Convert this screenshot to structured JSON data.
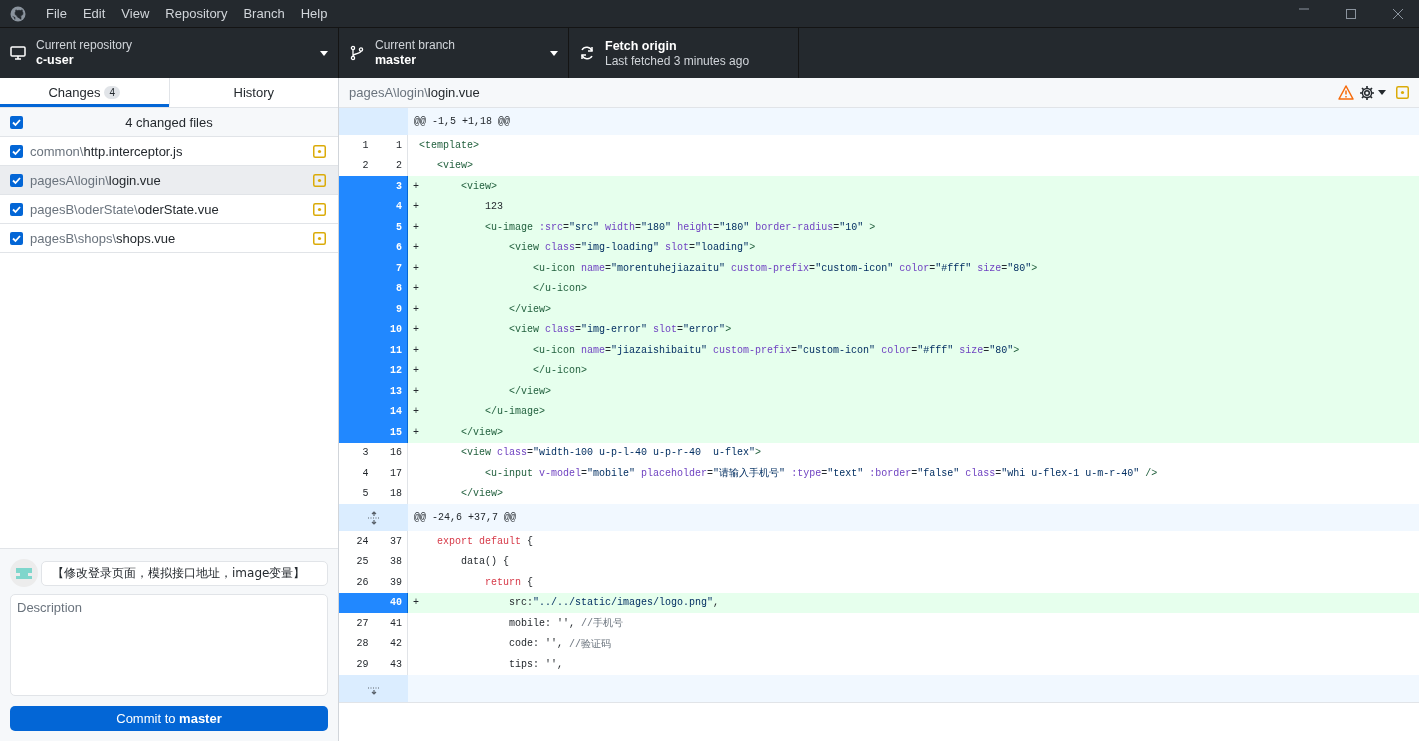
{
  "menu": [
    "File",
    "Edit",
    "View",
    "Repository",
    "Branch",
    "Help"
  ],
  "toolbar": {
    "repository": {
      "label": "Current repository",
      "value": "c-user"
    },
    "branch": {
      "label": "Current branch",
      "value": "master"
    },
    "fetch": {
      "title": "Fetch origin",
      "subtitle": "Last fetched 3 minutes ago"
    }
  },
  "sidebar": {
    "tabs": [
      {
        "label": "Changes",
        "count": "4",
        "selected": true
      },
      {
        "label": "History",
        "selected": false
      }
    ],
    "select_all": {
      "label": "4 changed files",
      "checked": true
    },
    "files": [
      {
        "dir": "common\\",
        "name": "http.interceptor.js",
        "checked": true,
        "selected": false
      },
      {
        "dir": "pagesA\\login\\",
        "name": "login.vue",
        "checked": true,
        "selected": true
      },
      {
        "dir": "pagesB\\oderState\\",
        "name": "oderState.vue",
        "checked": true,
        "selected": false
      },
      {
        "dir": "pagesB\\shops\\",
        "name": "shops.vue",
        "checked": true,
        "selected": false
      }
    ]
  },
  "commit": {
    "summary": "【修改登录页面，模拟接口地址，image变量】",
    "description_placeholder": "Description",
    "button": "Commit to **master**"
  },
  "diff": {
    "path_dir": "pagesA\\login\\",
    "path_file": "login.vue",
    "rows": [
      {
        "kind": "hunk",
        "text": "@@ -1,5 +1,18 @@",
        "expand_up": false,
        "expand_down": false
      },
      {
        "kind": "context",
        "old": "1",
        "new": "1",
        "tokens": [
          {
            "kind": "tag",
            "text": "<template>"
          }
        ]
      },
      {
        "kind": "context",
        "old": "2",
        "new": "2",
        "tokens": [
          {
            "kind": "tag",
            "text": "   <view>"
          }
        ]
      },
      {
        "kind": "added",
        "marker": "+",
        "new": "3",
        "tokens": [
          {
            "kind": "tag",
            "text": "       <view>"
          }
        ]
      },
      {
        "kind": "added",
        "marker": "+",
        "new": "4",
        "tokens": [
          {
            "kind": "plain",
            "text": "           123"
          }
        ]
      },
      {
        "kind": "added",
        "marker": "+",
        "new": "5",
        "tokens": [
          {
            "kind": "tag",
            "text": "           <u-image"
          },
          {
            "kind": "attr",
            "text": " :src"
          },
          {
            "kind": "plain",
            "text": "="
          },
          {
            "kind": "str",
            "text": "\"src\""
          },
          {
            "kind": "attr",
            "text": " width"
          },
          {
            "kind": "plain",
            "text": "="
          },
          {
            "kind": "str",
            "text": "\"180\""
          },
          {
            "kind": "attr",
            "text": " height"
          },
          {
            "kind": "plain",
            "text": "="
          },
          {
            "kind": "str",
            "text": "\"180\""
          },
          {
            "kind": "attr",
            "text": " border-radius"
          },
          {
            "kind": "plain",
            "text": "="
          },
          {
            "kind": "str",
            "text": "\"10\""
          },
          {
            "kind": "tag",
            "text": " >"
          }
        ]
      },
      {
        "kind": "added",
        "marker": "+",
        "new": "6",
        "tokens": [
          {
            "kind": "tag",
            "text": "               <view"
          },
          {
            "kind": "attr",
            "text": " class"
          },
          {
            "kind": "plain",
            "text": "="
          },
          {
            "kind": "str",
            "text": "\"img-loading\""
          },
          {
            "kind": "attr",
            "text": " slot"
          },
          {
            "kind": "plain",
            "text": "="
          },
          {
            "kind": "str",
            "text": "\"loading\""
          },
          {
            "kind": "tag",
            "text": ">"
          }
        ]
      },
      {
        "kind": "added",
        "marker": "+",
        "new": "7",
        "tokens": [
          {
            "kind": "tag",
            "text": "                   <u-icon"
          },
          {
            "kind": "attr",
            "text": " name"
          },
          {
            "kind": "plain",
            "text": "="
          },
          {
            "kind": "str",
            "text": "\"morentuhejiazaitu\""
          },
          {
            "kind": "attr",
            "text": " custom-prefix"
          },
          {
            "kind": "plain",
            "text": "="
          },
          {
            "kind": "str",
            "text": "\"custom-icon\""
          },
          {
            "kind": "attr",
            "text": " color"
          },
          {
            "kind": "plain",
            "text": "="
          },
          {
            "kind": "str",
            "text": "\"#fff\""
          },
          {
            "kind": "attr",
            "text": " size"
          },
          {
            "kind": "plain",
            "text": "="
          },
          {
            "kind": "str",
            "text": "\"80\""
          },
          {
            "kind": "tag",
            "text": ">"
          }
        ]
      },
      {
        "kind": "added",
        "marker": "+",
        "new": "8",
        "tokens": [
          {
            "kind": "tag",
            "text": "                   </u-icon>"
          }
        ]
      },
      {
        "kind": "added",
        "marker": "+",
        "new": "9",
        "tokens": [
          {
            "kind": "tag",
            "text": "               </view>"
          }
        ]
      },
      {
        "kind": "added",
        "marker": "+",
        "new": "10",
        "tokens": [
          {
            "kind": "tag",
            "text": "               <view"
          },
          {
            "kind": "attr",
            "text": " class"
          },
          {
            "kind": "plain",
            "text": "="
          },
          {
            "kind": "str",
            "text": "\"img-error\""
          },
          {
            "kind": "attr",
            "text": " slot"
          },
          {
            "kind": "plain",
            "text": "="
          },
          {
            "kind": "str",
            "text": "\"error\""
          },
          {
            "kind": "tag",
            "text": ">"
          }
        ]
      },
      {
        "kind": "added",
        "marker": "+",
        "new": "11",
        "tokens": [
          {
            "kind": "tag",
            "text": "                   <u-icon"
          },
          {
            "kind": "attr",
            "text": " name"
          },
          {
            "kind": "plain",
            "text": "="
          },
          {
            "kind": "str",
            "text": "\"jiazaishibaitu\""
          },
          {
            "kind": "attr",
            "text": " custom-prefix"
          },
          {
            "kind": "plain",
            "text": "="
          },
          {
            "kind": "str",
            "text": "\"custom-icon\""
          },
          {
            "kind": "attr",
            "text": " color"
          },
          {
            "kind": "plain",
            "text": "="
          },
          {
            "kind": "str",
            "text": "\"#fff\""
          },
          {
            "kind": "attr",
            "text": " size"
          },
          {
            "kind": "plain",
            "text": "="
          },
          {
            "kind": "str",
            "text": "\"80\""
          },
          {
            "kind": "tag",
            "text": ">"
          }
        ]
      },
      {
        "kind": "added",
        "marker": "+",
        "new": "12",
        "tokens": [
          {
            "kind": "tag",
            "text": "                   </u-icon>"
          }
        ]
      },
      {
        "kind": "added",
        "marker": "+",
        "new": "13",
        "tokens": [
          {
            "kind": "tag",
            "text": "               </view>"
          }
        ]
      },
      {
        "kind": "added",
        "marker": "+",
        "new": "14",
        "tokens": [
          {
            "kind": "tag",
            "text": "           </u-image>"
          }
        ]
      },
      {
        "kind": "added",
        "marker": "+",
        "new": "15",
        "tokens": [
          {
            "kind": "tag",
            "text": "       </view>"
          }
        ]
      },
      {
        "kind": "context",
        "old": "3",
        "new": "16",
        "tokens": [
          {
            "kind": "tag",
            "text": "       <view"
          },
          {
            "kind": "attr",
            "text": " class"
          },
          {
            "kind": "plain",
            "text": "="
          },
          {
            "kind": "str",
            "text": "\"width-100 u-p-l-40 u-p-r-40  u-flex\""
          },
          {
            "kind": "tag",
            "text": ">"
          }
        ]
      },
      {
        "kind": "context",
        "old": "4",
        "new": "17",
        "tokens": [
          {
            "kind": "tag",
            "text": "           <u-input"
          },
          {
            "kind": "attr",
            "text": " v-model"
          },
          {
            "kind": "plain",
            "text": "="
          },
          {
            "kind": "str",
            "text": "\"mobile\""
          },
          {
            "kind": "attr",
            "text": " placeholder"
          },
          {
            "kind": "plain",
            "text": "="
          },
          {
            "kind": "str",
            "text": "\"请输入手机号\""
          },
          {
            "kind": "attr",
            "text": " :type"
          },
          {
            "kind": "plain",
            "text": "="
          },
          {
            "kind": "str",
            "text": "\"text\""
          },
          {
            "kind": "attr",
            "text": " :border"
          },
          {
            "kind": "plain",
            "text": "="
          },
          {
            "kind": "str",
            "text": "\"false\""
          },
          {
            "kind": "attr",
            "text": " class"
          },
          {
            "kind": "plain",
            "text": "="
          },
          {
            "kind": "str",
            "text": "\"whi u-flex-1 u-m-r-40\""
          },
          {
            "kind": "tag",
            "text": " />"
          }
        ]
      },
      {
        "kind": "context",
        "old": "5",
        "new": "18",
        "tokens": [
          {
            "kind": "tag",
            "text": "       </view>"
          }
        ]
      },
      {
        "kind": "hunk",
        "text": "@@ -24,6 +37,7 @@",
        "expand_up": true,
        "expand_down": true
      },
      {
        "kind": "context",
        "old": "24",
        "new": "37",
        "tokens": [
          {
            "kind": "kw",
            "text": "   export default"
          },
          {
            "kind": "plain",
            "text": " {"
          }
        ]
      },
      {
        "kind": "context",
        "old": "25",
        "new": "38",
        "tokens": [
          {
            "kind": "plain",
            "text": "       data() {"
          }
        ]
      },
      {
        "kind": "context",
        "old": "26",
        "new": "39",
        "tokens": [
          {
            "kind": "kw",
            "text": "           return"
          },
          {
            "kind": "plain",
            "text": " {"
          }
        ]
      },
      {
        "kind": "added",
        "marker": "+",
        "new": "40",
        "tokens": [
          {
            "kind": "plain",
            "text": "               src:"
          },
          {
            "kind": "str",
            "text": "\"../../static/images/logo.png\""
          },
          {
            "kind": "plain",
            "text": ","
          }
        ]
      },
      {
        "kind": "context",
        "old": "27",
        "new": "41",
        "tokens": [
          {
            "kind": "plain",
            "text": "               mobile: '', "
          },
          {
            "kind": "comment",
            "text": "//手机号"
          }
        ]
      },
      {
        "kind": "context",
        "old": "28",
        "new": "42",
        "tokens": [
          {
            "kind": "plain",
            "text": "               code: '', "
          },
          {
            "kind": "comment",
            "text": "//验证码"
          }
        ]
      },
      {
        "kind": "context",
        "old": "29",
        "new": "43",
        "tokens": [
          {
            "kind": "plain",
            "text": "               tips: '',"
          }
        ]
      },
      {
        "kind": "hunk",
        "expand_up": false,
        "expand_down": true
      }
    ]
  }
}
